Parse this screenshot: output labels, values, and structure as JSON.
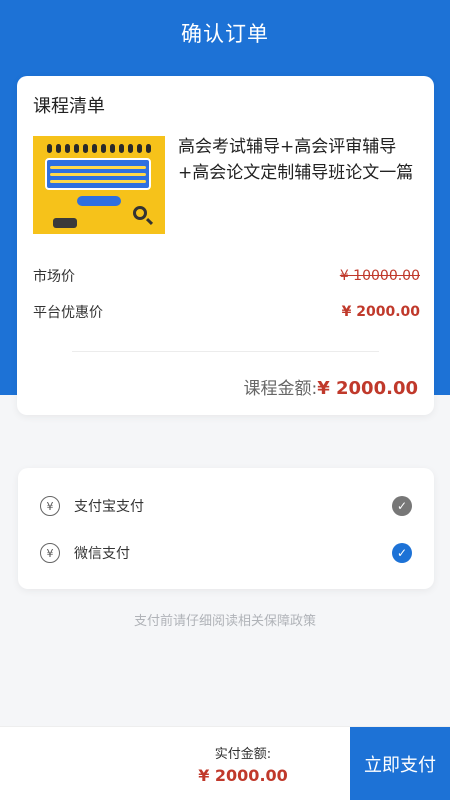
{
  "header": {
    "title": "确认订单"
  },
  "course": {
    "section_title": "课程清单",
    "name": "高会考试辅导+高会评审辅导+高会论文定制辅导班论文一篇",
    "market_label": "市场价",
    "market_price": "¥ 10000.00",
    "platform_label": "平台优惠价",
    "platform_price": "¥ 2000.00",
    "total_label": "课程金额:",
    "total_amount": "¥ 2000.00"
  },
  "payment": {
    "methods": [
      {
        "label": "支付宝支付",
        "icon": "yen-circle-icon",
        "selected": false,
        "check_icon": "check-circle-icon"
      },
      {
        "label": "微信支付",
        "icon": "yen-circle-icon",
        "selected": true,
        "check_icon": "check-circle-icon"
      }
    ],
    "yen_glyph": "¥",
    "check_glyph": "✓"
  },
  "notice": "支付前请仔细阅读相关保障政策",
  "footer": {
    "label": "实付金额:",
    "amount": "¥ 2000.00",
    "button": "立即支付"
  },
  "colors": {
    "primary": "#1d72d6",
    "price_red": "#c0392b",
    "unselected": "#777777"
  }
}
